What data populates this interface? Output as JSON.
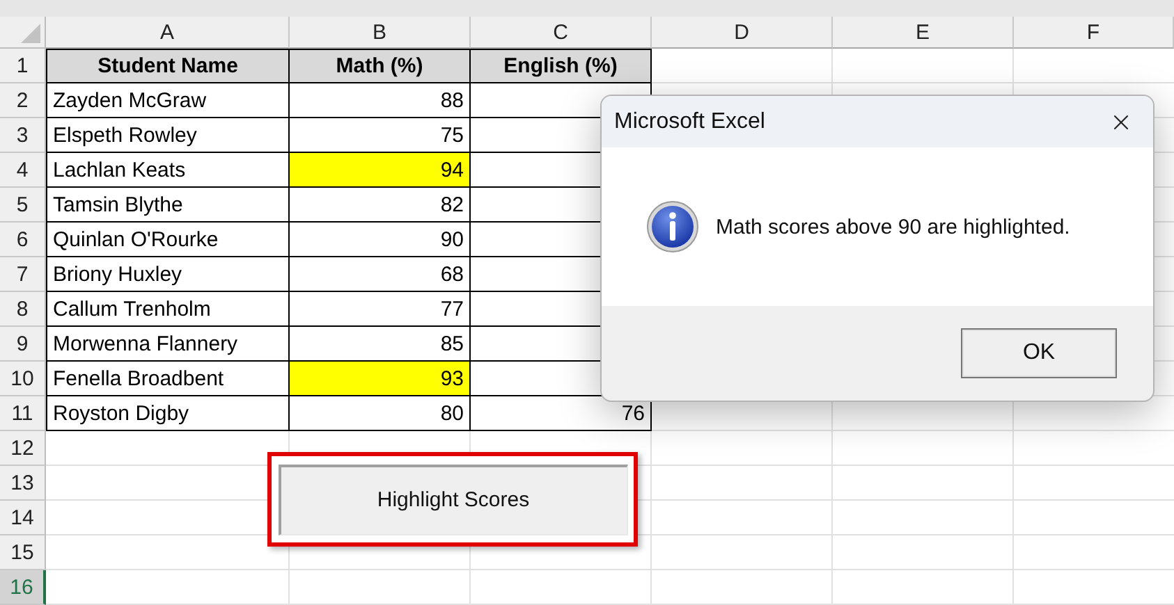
{
  "column_headers": [
    "A",
    "B",
    "C",
    "D",
    "E",
    "F"
  ],
  "row_headers": [
    {
      "label": "1",
      "selected": false
    },
    {
      "label": "2",
      "selected": false
    },
    {
      "label": "3",
      "selected": false
    },
    {
      "label": "4",
      "selected": false
    },
    {
      "label": "5",
      "selected": false
    },
    {
      "label": "6",
      "selected": false
    },
    {
      "label": "7",
      "selected": false
    },
    {
      "label": "8",
      "selected": false
    },
    {
      "label": "9",
      "selected": false
    },
    {
      "label": "10",
      "selected": false
    },
    {
      "label": "11",
      "selected": false
    },
    {
      "label": "12",
      "selected": false
    },
    {
      "label": "13",
      "selected": false
    },
    {
      "label": "14",
      "selected": false
    },
    {
      "label": "15",
      "selected": false
    },
    {
      "label": "16",
      "selected": true
    }
  ],
  "table": {
    "columns": [
      "Student Name",
      "Math (%)",
      "English (%)"
    ],
    "rows": [
      {
        "name": "Zayden McGraw",
        "math": "88",
        "highlighted": false
      },
      {
        "name": "Elspeth Rowley",
        "math": "75",
        "highlighted": false
      },
      {
        "name": "Lachlan Keats",
        "math": "94",
        "highlighted": true
      },
      {
        "name": "Tamsin Blythe",
        "math": "82",
        "highlighted": false
      },
      {
        "name": "Quinlan O'Rourke",
        "math": "90",
        "highlighted": false
      },
      {
        "name": "Briony Huxley",
        "math": "68",
        "highlighted": false
      },
      {
        "name": "Callum Trenholm",
        "math": "77",
        "highlighted": false
      },
      {
        "name": "Morwenna Flannery",
        "math": "85",
        "highlighted": false
      },
      {
        "name": "Fenella Broadbent",
        "math": "93",
        "highlighted": true
      },
      {
        "name": "Royston Digby",
        "math": "80",
        "highlighted": false,
        "english": "76"
      }
    ]
  },
  "macro_button": {
    "label": "Highlight Scores"
  },
  "dialog": {
    "title": "Microsoft Excel",
    "message": "Math scores above 90 are highlighted.",
    "buttons": [
      "OK"
    ]
  }
}
